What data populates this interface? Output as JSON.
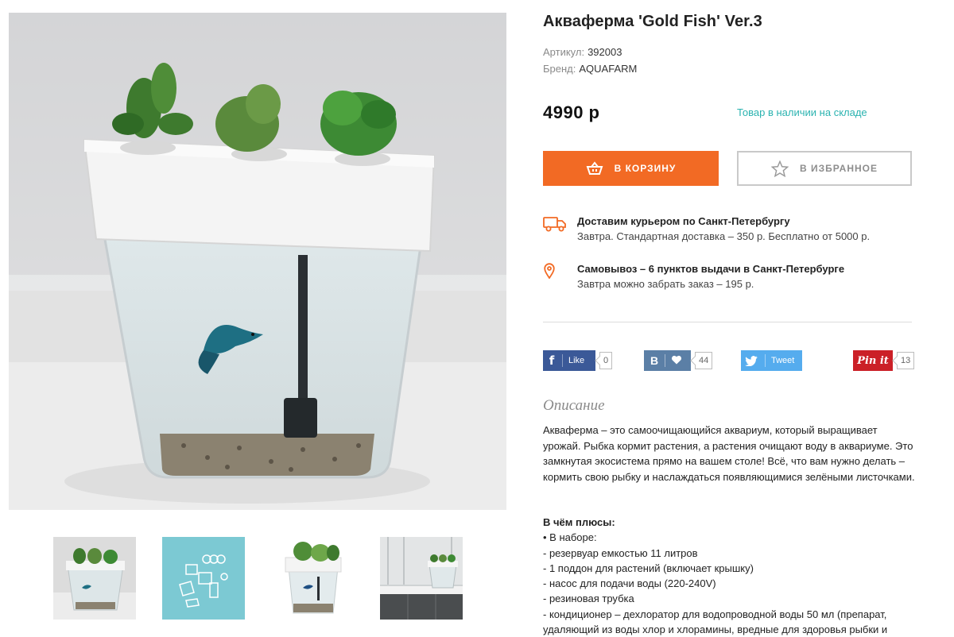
{
  "product": {
    "title": "Акваферма 'Gold Fish' Ver.3",
    "sku_label": "Артикул:",
    "sku": "392003",
    "brand_label": "Бренд:",
    "brand": "AQUAFARM",
    "price": "4990 р",
    "stock": "Товар в наличии на складе"
  },
  "buttons": {
    "cart": "В КОРЗИНУ",
    "favorite": "В ИЗБРАННОЕ"
  },
  "delivery": [
    {
      "icon": "truck-icon",
      "title": "Доставим курьером по Санкт-Петербургу",
      "text": "Завтра. Стандартная доставка – 350 р. Бесплатно от 5000 р."
    },
    {
      "icon": "map-pin-icon",
      "title": "Самовывоз – 6 пунктов выдачи в Санкт-Петербурге",
      "text": "Завтра можно забрать заказ – 195 р."
    }
  ],
  "social": {
    "facebook": {
      "label": "Like",
      "count": "0"
    },
    "vk": {
      "logo": "B",
      "count": "44"
    },
    "twitter": {
      "label": "Tweet"
    },
    "pinterest": {
      "label": "Pin it",
      "count": "13"
    }
  },
  "description": {
    "title": "Описание",
    "text": "Акваферма – это самоочищающийся аквариум, который выращивает урожай. Рыбка кормит растения, а растения очищают воду в аквариуме. Это замкнутая экосистема прямо на вашем столе! Всё, что вам нужно делать – кормить свою рыбку и наслаждаться появляющимися зелёными листочками.",
    "pros_title": "В чём плюсы:",
    "pros": [
      "• В наборе:",
      "- резервуар емкостью 11 литров",
      "- 1 поддон для растений (включает крышку)",
      "- насос для подачи воды (220-240V)",
      "- резиновая трубка",
      "- кондиционер – дехлоратор для водопроводной воды 50 мл (препарат,",
      "удаляющий из воды хлор и хлорамины, вредные для здоровья рыбки и"
    ]
  },
  "colors": {
    "accent": "#f26a24",
    "stock": "#2bb3b0",
    "facebook": "#3b5998",
    "vk": "#5b7fa6",
    "twitter": "#55acee",
    "pinterest": "#cb2027"
  }
}
